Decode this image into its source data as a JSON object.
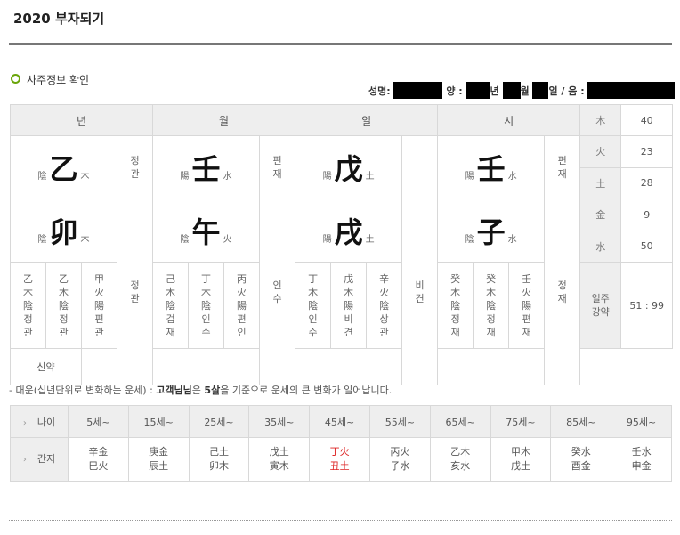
{
  "title": "2020 부자되기",
  "section_title": "사주정보 확인",
  "info": {
    "name_label": "성명:",
    "yang_label": "양 :",
    "year_label": "년",
    "month_label": "월",
    "day_label": "일 / 음 :"
  },
  "pillars": [
    {
      "header": "년",
      "stem_yy": "陰",
      "stem": "乙",
      "stem_el": "木",
      "stem_god": "정관",
      "branch_yy": "陰",
      "branch": "卯",
      "branch_el": "木",
      "branch_god": "정관",
      "hidden": [
        [
          "乙",
          "木",
          "陰",
          "정",
          "관"
        ],
        [
          "乙",
          "木",
          "陰",
          "정",
          "관"
        ],
        [
          "甲",
          "火",
          "陽",
          "편",
          "관"
        ]
      ]
    },
    {
      "header": "월",
      "stem_yy": "陽",
      "stem": "壬",
      "stem_el": "水",
      "stem_god": "편재",
      "branch_yy": "陰",
      "branch": "午",
      "branch_el": "火",
      "branch_god": "인수",
      "hidden": [
        [
          "己",
          "木",
          "陰",
          "겁",
          "재"
        ],
        [
          "丁",
          "木",
          "陰",
          "인",
          "수"
        ],
        [
          "丙",
          "火",
          "陽",
          "편",
          "인"
        ]
      ]
    },
    {
      "header": "일",
      "stem_yy": "陽",
      "stem": "戊",
      "stem_el": "土",
      "stem_god": "",
      "branch_yy": "陽",
      "branch": "戌",
      "branch_el": "土",
      "branch_god": "비견",
      "hidden": [
        [
          "丁",
          "木",
          "陰",
          "인",
          "수"
        ],
        [
          "戊",
          "木",
          "陽",
          "비",
          "견"
        ],
        [
          "辛",
          "火",
          "陰",
          "상",
          "관"
        ]
      ]
    },
    {
      "header": "시",
      "stem_yy": "陽",
      "stem": "壬",
      "stem_el": "水",
      "stem_god": "편재",
      "branch_yy": "陰",
      "branch": "子",
      "branch_el": "水",
      "branch_god": "정재",
      "hidden": [
        [
          "癸",
          "木",
          "陰",
          "정",
          "재"
        ],
        [
          "癸",
          "木",
          "陰",
          "정",
          "재"
        ],
        [
          "壬",
          "火",
          "陽",
          "편",
          "재"
        ]
      ]
    }
  ],
  "elements": [
    {
      "name": "木",
      "value": "40"
    },
    {
      "name": "火",
      "value": "23"
    },
    {
      "name": "土",
      "value": "28"
    },
    {
      "name": "金",
      "value": "9"
    },
    {
      "name": "水",
      "value": "50"
    }
  ],
  "strength": {
    "label": "일주\n강약",
    "value": "51 : 99",
    "result": "신약"
  },
  "daeun_note": {
    "prefix": "- 대운(십년단위로 변화하는 운세) : ",
    "bold1": "고객님님",
    "mid": "은 ",
    "bold2": "5살",
    "suffix": "을 기준으로 운세의 큰 변화가 일어납니다."
  },
  "daeun": {
    "age_label": "나이",
    "gz_label": "간지",
    "ages": [
      "5세~",
      "15세~",
      "25세~",
      "35세~",
      "45세~",
      "55세~",
      "65세~",
      "75세~",
      "85세~",
      "95세~"
    ],
    "stems": [
      "辛金",
      "庚金",
      "己土",
      "戊土",
      "丁火",
      "丙火",
      "乙木",
      "甲木",
      "癸水",
      "壬水"
    ],
    "branches": [
      "巳火",
      "辰土",
      "卯木",
      "寅木",
      "丑土",
      "子水",
      "亥水",
      "戌土",
      "酉金",
      "申金"
    ],
    "highlight_index": 4,
    "highlight_color": "#dd2222"
  }
}
